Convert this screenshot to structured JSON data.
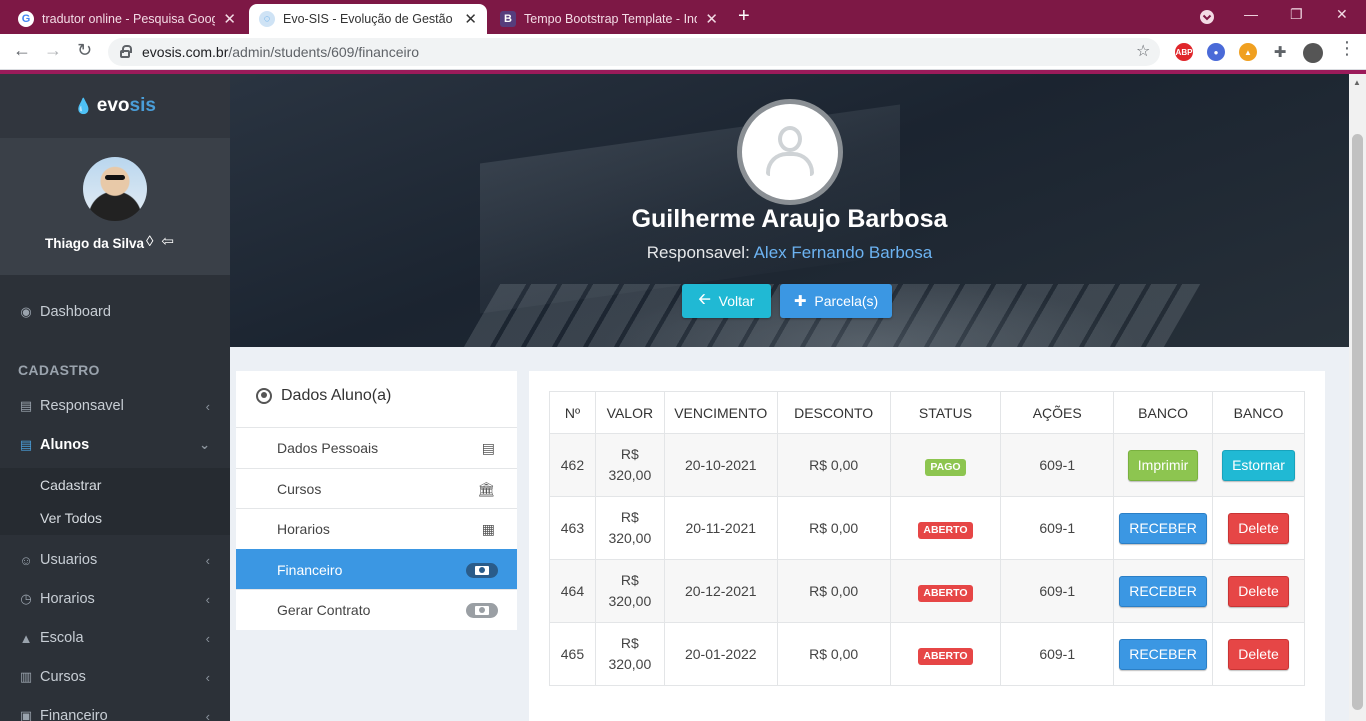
{
  "browser": {
    "tabs": [
      {
        "title": "tradutor online - Pesquisa Google",
        "favicon": "google-icon"
      },
      {
        "title": "Evo-SIS - Evolução de Gestão Escolar",
        "favicon": "evosis-icon"
      },
      {
        "title": "Tempo Bootstrap Template - Index",
        "favicon": "bootstrap-icon"
      }
    ],
    "favicon_b": "B",
    "url_host": "evosis.com.br",
    "url_path": "/admin/students/609/financeiro",
    "ext_abp": "ABP"
  },
  "sidebar": {
    "brand_evo": "evo",
    "brand_sis": "sis",
    "user_name": "Thiago da Silva",
    "dashboard": "Dashboard",
    "section_header": "CADASTRO",
    "items": {
      "responsavel": "Responsavel",
      "alunos": "Alunos",
      "cadastrar": "Cadastrar",
      "ver_todos": "Ver Todos",
      "usuarios": "Usuarios",
      "horarios": "Horarios",
      "escola": "Escola",
      "cursos": "Cursos",
      "financeiro": "Financeiro"
    }
  },
  "hero": {
    "student_name": "Guilherme Araujo Barbosa",
    "responsavel_label": "Responsavel:",
    "responsavel_name": "Alex Fernando Barbosa",
    "voltar": "Voltar",
    "parcelas": "Parcela(s)"
  },
  "left_panel": {
    "title": "Dados Aluno(a)",
    "items": [
      "Dados Pessoais",
      "Cursos",
      "Horarios",
      "Financeiro",
      "Gerar Contrato"
    ],
    "active": "Financeiro"
  },
  "table": {
    "headers": [
      "Nº",
      "VALOR",
      "VENCIMENTO",
      "DESCONTO",
      "STATUS",
      "AÇÕES",
      "BANCO",
      "BANCO"
    ],
    "rows": [
      {
        "n": "462",
        "valor_a": "R$",
        "valor_b": "320,00",
        "vencimento": "20-10-2021",
        "desconto": "R$ 0,00",
        "status": "PAGO",
        "acoes": "609-1",
        "btn1": "Imprimir",
        "btn2": "Estornar"
      },
      {
        "n": "463",
        "valor_a": "R$",
        "valor_b": "320,00",
        "vencimento": "20-11-2021",
        "desconto": "R$ 0,00",
        "status": "ABERTO",
        "acoes": "609-1",
        "btn1": "RECEBER",
        "btn2": "Delete"
      },
      {
        "n": "464",
        "valor_a": "R$",
        "valor_b": "320,00",
        "vencimento": "20-12-2021",
        "desconto": "R$ 0,00",
        "status": "ABERTO",
        "acoes": "609-1",
        "btn1": "RECEBER",
        "btn2": "Delete"
      },
      {
        "n": "465",
        "valor_a": "R$",
        "valor_b": "320,00",
        "vencimento": "20-01-2022",
        "desconto": "R$ 0,00",
        "status": "ABERTO",
        "acoes": "609-1",
        "btn1": "RECEBER",
        "btn2": "Delete"
      }
    ]
  },
  "colors": {
    "browser_frame": "#7d1845",
    "sidebar_bg": "#2c3138",
    "accent_blue": "#3b97e3",
    "accent_cyan": "#20b9d4",
    "success_green": "#8dc550",
    "danger_red": "#e64646"
  }
}
